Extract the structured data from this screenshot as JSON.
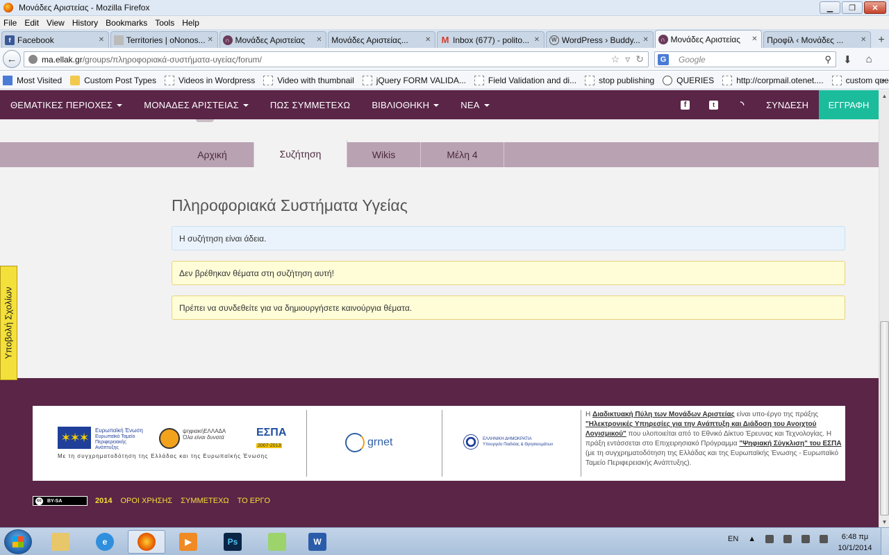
{
  "window": {
    "title": "Μονάδες Αριστείας - Mozilla Firefox"
  },
  "menu": [
    "File",
    "Edit",
    "View",
    "History",
    "Bookmarks",
    "Tools",
    "Help"
  ],
  "tabs": [
    {
      "label": "Facebook",
      "icon": "facebook-icon"
    },
    {
      "label": "Territories | oNonos...",
      "icon": "page-icon"
    },
    {
      "label": "Μονάδες Αριστείας",
      "icon": "ma-icon"
    },
    {
      "label": "Μονάδες Αριστείας...",
      "icon": "page-icon"
    },
    {
      "label": "Inbox (677) - polito...",
      "icon": "gmail-icon"
    },
    {
      "label": "WordPress › Buddy...",
      "icon": "wordpress-icon"
    },
    {
      "label": "Μονάδες Αριστείας",
      "icon": "ma-icon",
      "active": true
    },
    {
      "label": "Προφίλ ‹ Μονάδες ...",
      "icon": "page-icon"
    }
  ],
  "nav": {
    "url_domain": "ma.ellak.gr",
    "url_path": "/groups/πληροφοριακά-συστήματα-υγείας/forum/",
    "search_placeholder": "Google",
    "search_engine": "G"
  },
  "bookmarks": [
    "Most Visited",
    "Custom Post Types",
    "Videos in Wordpress",
    "Video with thumbnail",
    "jQuery FORM VALIDA...",
    "Field Validation and di...",
    "stop publishing",
    "QUERIES",
    "http://corpmail.otenet....",
    "custom queries"
  ],
  "site": {
    "menu": [
      {
        "label": "ΘΕΜΑΤΙΚΕΣ ΠΕΡΙΟΧΕΣ",
        "dropdown": true
      },
      {
        "label": "ΜΟΝΑΔΕΣ ΑΡΙΣΤΕΙΑΣ",
        "dropdown": true
      },
      {
        "label": "ΠΩΣ ΣΥΜΜΕΤΕΧΩ",
        "dropdown": false
      },
      {
        "label": "ΒΙΒΛΙΟΘΗΚΗ",
        "dropdown": true
      },
      {
        "label": "ΝΕΑ",
        "dropdown": true
      }
    ],
    "login": "ΣΥΝΔΕΣΗ",
    "register": "ΕΓΓΡΑΦΗ",
    "accent_color": "#5a2547",
    "register_color": "#1abc9c"
  },
  "group": {
    "tabs": [
      {
        "label": "Αρχική",
        "active": false
      },
      {
        "label": "Συζήτηση",
        "active": true
      },
      {
        "label": "Wikis",
        "active": false
      },
      {
        "label": "Μέλη 4",
        "active": false
      }
    ],
    "title": "Πληροφοριακά Συστήματα Υγείας",
    "alerts": [
      "Η συζήτηση είναι άδεια.",
      "Δεν βρέθηκαν θέματα στη συζήτηση αυτή!",
      "Πρέπει να συνδεθείτε για να δημιουργήσετε καινούργια θέματα."
    ]
  },
  "comments_tab": "Υποβολή Σχολίων",
  "footer": {
    "eu_title": "Ευρωπαϊκή Ένωση",
    "eu_sub1": "Ευρωπαϊκό Ταμείο",
    "eu_sub2": "Περιφερειακής",
    "eu_sub3": "Ανάπτυξης",
    "psif_title": "ψηφιακήΕΛΛΑΔΑ",
    "psif_sub": "Όλα είναι δυνατά",
    "espa": "ΕΣΠΑ",
    "espa_years": "2007-2013",
    "eu_caption": "Με τη συγχρηματοδότηση της Ελλάδας και της Ευρωπαϊκής Ένωσης",
    "grnet": "grnet",
    "gov1": "ΕΛΛΗΝΙΚΗ ΔΗΜΟΚΡΑΤΙΑ",
    "gov2": "Υπουργείο Παιδείας & Θρησκευμάτων",
    "text_p1": "Η ",
    "text_link1": "Διαδικτυακή Πύλη των Μονάδων Αριστείας",
    "text_p2": " είναι υπο-έργο της πράξης ",
    "text_link2": "\"Ηλεκτρονικές Υπηρεσίες για την Ανάπτυξη και Διάδοση του Ανοιχτού Λογισμικού\"",
    "text_p3": " που υλοποιείται από το Εθνικό Δίκτυο Έρευνας και Τεχνολογίας. Η πράξη εντάσσεται στο Επιχειρησιακό Πρόγραμμα ",
    "text_link3": "\"Ψηφιακή Σύγκλιση\" του ΕΣΠΑ",
    "text_p4": " (με τη συγχρηματοδότηση της Ελλάδας και της Ευρωπαϊκής Ένωσης - Ευρωπαϊκό Ταμείο Περιφερειακής Ανάπτυξης).",
    "license": "BY-SA",
    "year": "2014",
    "links": [
      "ΟΡΟΙ ΧΡΗΣΗΣ",
      "ΣΥΜΜΕΤΕΧΩ",
      "ΤΟ ΕΡΓΟ"
    ]
  },
  "taskbar": {
    "lang": "EN",
    "time": "6:48 πμ",
    "date": "10/1/2014"
  }
}
